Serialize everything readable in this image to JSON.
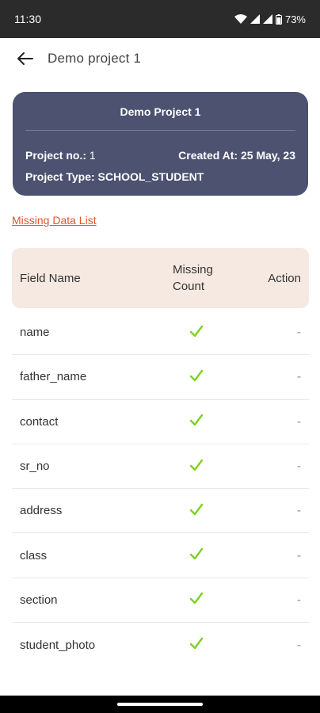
{
  "status_bar": {
    "time": "11:30",
    "battery": "73%"
  },
  "app_bar": {
    "title": "Demo project 1"
  },
  "project": {
    "title": "Demo Project 1",
    "project_no_label": "Project no.:",
    "project_no": "1",
    "created_label": "Created At:",
    "created_at": "25 May, 23",
    "type_label": "Project Type:",
    "type": "SCHOOL_STUDENT"
  },
  "missing_link": "Missing Data List",
  "table": {
    "headers": {
      "field": "Field Name",
      "count": "Missing Count",
      "action": "Action"
    },
    "rows": [
      {
        "field": "name",
        "action": "-"
      },
      {
        "field": "father_name",
        "action": "-"
      },
      {
        "field": "contact",
        "action": "-"
      },
      {
        "field": "sr_no",
        "action": "-"
      },
      {
        "field": "address",
        "action": "-"
      },
      {
        "field": "class",
        "action": "-"
      },
      {
        "field": "section",
        "action": "-"
      },
      {
        "field": "student_photo",
        "action": "-"
      }
    ]
  },
  "colors": {
    "card": "#4c5270",
    "link": "#e05532",
    "check": "#7bd321",
    "header_bg": "#f6e9e1"
  }
}
